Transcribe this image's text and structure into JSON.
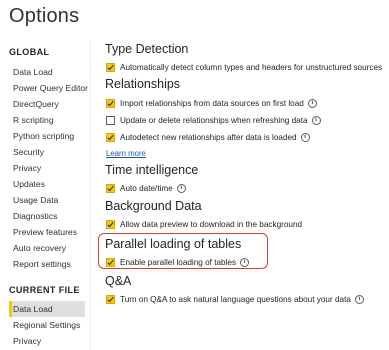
{
  "title": "Options",
  "sidebar": {
    "global_heading": "GLOBAL",
    "global_items": [
      {
        "label": "Data Load"
      },
      {
        "label": "Power Query Editor"
      },
      {
        "label": "DirectQuery"
      },
      {
        "label": "R scripting"
      },
      {
        "label": "Python scripting"
      },
      {
        "label": "Security"
      },
      {
        "label": "Privacy"
      },
      {
        "label": "Updates"
      },
      {
        "label": "Usage Data"
      },
      {
        "label": "Diagnostics"
      },
      {
        "label": "Preview features"
      },
      {
        "label": "Auto recovery"
      },
      {
        "label": "Report settings"
      }
    ],
    "current_file_heading": "CURRENT FILE",
    "current_file_items": [
      {
        "label": "Data Load",
        "selected": true
      },
      {
        "label": "Regional Settings"
      },
      {
        "label": "Privacy"
      }
    ]
  },
  "sections": {
    "type_detection": {
      "heading": "Type Detection",
      "options": [
        {
          "label": "Automatically detect column types and headers for unstructured sources",
          "checked": true
        }
      ]
    },
    "relationships": {
      "heading": "Relationships",
      "options": [
        {
          "label": "Import relationships from data sources on first load",
          "checked": true
        },
        {
          "label": "Update or delete relationships when refreshing data",
          "checked": false
        },
        {
          "label": "Autodetect new relationships after data is loaded",
          "checked": true
        }
      ],
      "link": "Learn more"
    },
    "time_intelligence": {
      "heading": "Time intelligence",
      "options": [
        {
          "label": "Auto date/time",
          "checked": true
        }
      ]
    },
    "background_data": {
      "heading": "Background Data",
      "options": [
        {
          "label": "Allow data preview to download in the background",
          "checked": true
        }
      ]
    },
    "parallel_loading": {
      "heading": "Parallel loading of tables",
      "options": [
        {
          "label": "Enable parallel loading of tables",
          "checked": true
        }
      ]
    },
    "qna": {
      "heading": "Q&A",
      "options": [
        {
          "label": "Turn on Q&A to ask natural language questions about your data",
          "checked": true
        }
      ]
    }
  },
  "info_glyph": "i",
  "colors": {
    "checkbox_accent": "#f2c811",
    "highlight_border": "#d83b3b",
    "link": "#1f5ca3",
    "selected_item_bg": "#e1dfdd"
  },
  "icons": {
    "info": "info-icon",
    "checkbox": "checkbox-icon"
  }
}
